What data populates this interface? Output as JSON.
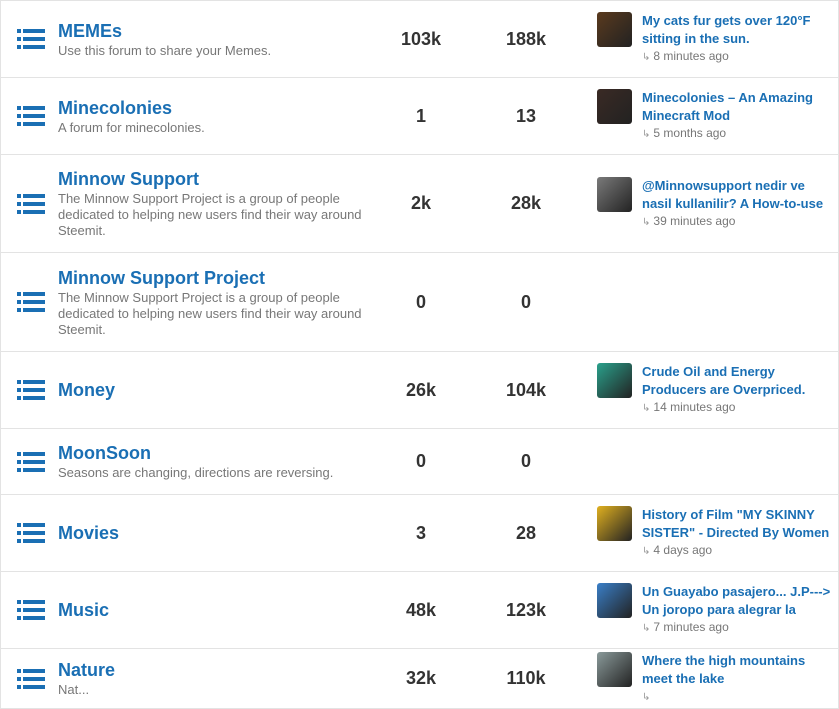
{
  "forums": [
    {
      "name": "MEMEs",
      "description": "Use this forum to share your Memes.",
      "posts": "103k",
      "replies": "188k",
      "last": {
        "title": "My cats fur gets over 120°F sitting in the sun.",
        "time": "8 minutes ago",
        "avatar": "cat-avatar",
        "avatar_color": "#5a3a1e"
      }
    },
    {
      "name": "Minecolonies",
      "description": "A forum for minecolonies.",
      "posts": "1",
      "replies": "13",
      "last": {
        "title": "Minecolonies – An Amazing Minecraft Mod",
        "time": "5 months ago",
        "avatar": "person-avatar",
        "avatar_color": "#3a2a24"
      }
    },
    {
      "name": "Minnow Support",
      "description": "The Minnow Support Project is a group of people dedicated to helping new users find their way around Steemit.",
      "posts": "2k",
      "replies": "28k",
      "last": {
        "title": "@Minnowsupport nedir ve nasil kullanilir? A How-to-use",
        "time": "39 minutes ago",
        "avatar": "statue-avatar",
        "avatar_color": "#7a7a7a"
      }
    },
    {
      "name": "Minnow Support Project",
      "description": "The Minnow Support Project is a group of people dedicated to helping new users find their way around Steemit.",
      "posts": "0",
      "replies": "0",
      "last": null
    },
    {
      "name": "Money",
      "description": "",
      "posts": "26k",
      "replies": "104k",
      "last": {
        "title": "Crude Oil and Energy Producers are Overpriced.",
        "time": "14 minutes ago",
        "avatar": "steem-logo-avatar",
        "avatar_color": "#2aa18c"
      }
    },
    {
      "name": "MoonSoon",
      "description": "Seasons are changing, directions are reversing.",
      "posts": "0",
      "replies": "0",
      "last": null
    },
    {
      "name": "Movies",
      "description": "",
      "posts": "3",
      "replies": "28",
      "last": {
        "title": "History of Film \"MY SKINNY SISTER\" - Directed By Women",
        "time": "4 days ago",
        "avatar": "person-yellow-avatar",
        "avatar_color": "#e0b020"
      }
    },
    {
      "name": "Music",
      "description": "",
      "posts": "48k",
      "replies": "123k",
      "last": {
        "title": "Un Guayabo pasajero... J.P---> Un joropo para alegrar la",
        "time": "7 minutes ago",
        "avatar": "person-blue-avatar",
        "avatar_color": "#3a7fc8"
      }
    },
    {
      "name": "Nature",
      "description": "Nat...",
      "posts": "32k",
      "replies": "110k",
      "last": {
        "title": "Where the high mountains meet the lake",
        "time": "",
        "avatar": "landscape-avatar",
        "avatar_color": "#8a9a9a"
      }
    }
  ]
}
